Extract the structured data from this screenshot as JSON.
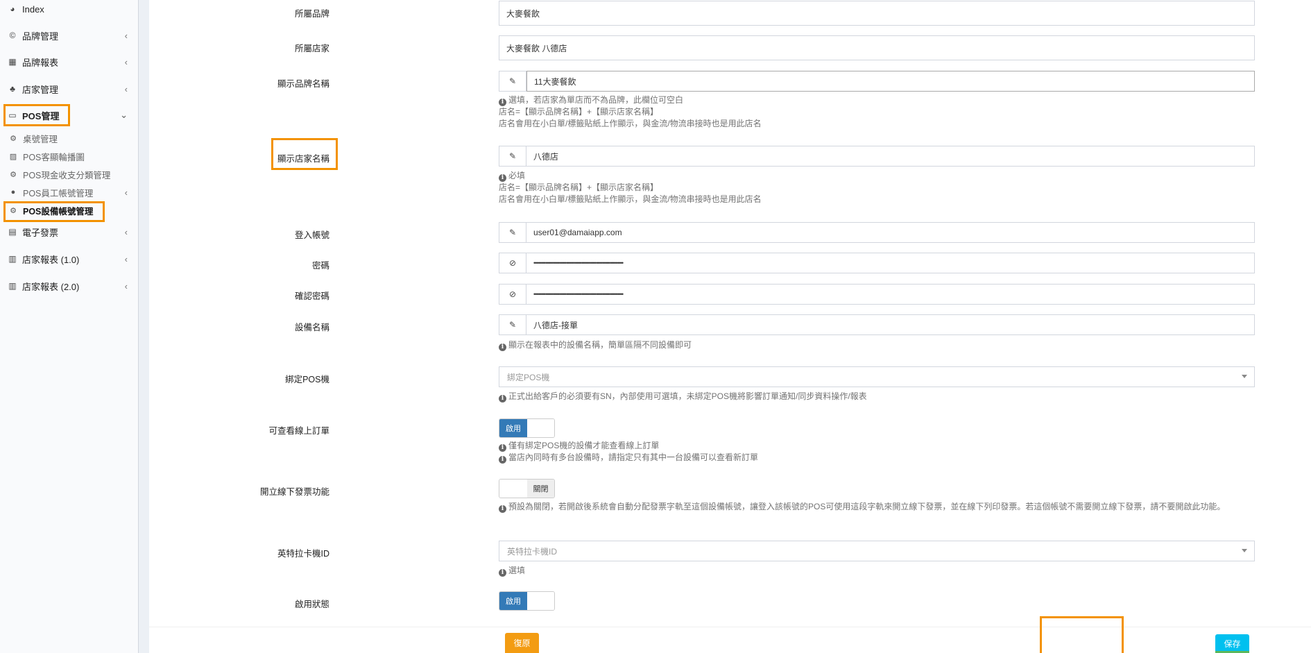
{
  "sidebar": {
    "items": [
      {
        "label": "Index",
        "icon": "dashboard-icon"
      },
      {
        "label": "品牌管理",
        "icon": "copyright-icon"
      },
      {
        "label": "品牌報表",
        "icon": "table-icon"
      },
      {
        "label": "店家管理",
        "icon": "sitemap-icon"
      },
      {
        "label": "POS管理",
        "icon": "desktop-icon"
      },
      {
        "label": "電子發票",
        "icon": "invoice-icon"
      },
      {
        "label": "店家報表 (1.0)",
        "icon": "bar-chart-icon"
      },
      {
        "label": "店家報表 (2.0)",
        "icon": "bar-chart-icon"
      }
    ],
    "pos_sub": [
      {
        "label": "桌號管理",
        "icon": "gear-icon"
      },
      {
        "label": "POS客顯輪播圖",
        "icon": "image-icon"
      },
      {
        "label": "POS現金收支分類管理",
        "icon": "gear-icon"
      },
      {
        "label": "POS員工帳號管理",
        "icon": "user-icon"
      },
      {
        "label": "POS設備帳號管理",
        "icon": "gear-icon"
      }
    ]
  },
  "form": {
    "brand": {
      "label": "所屬品牌",
      "value": "大麥餐飲"
    },
    "store": {
      "label": "所屬店家",
      "value": "大麥餐飲 八德店"
    },
    "display_brand": {
      "label": "顯示品牌名稱",
      "value": "11大麥餐飲",
      "help": [
        "選填，若店家為單店而不為品牌，此欄位可空白",
        "店名=【顯示品牌名稱】+【顯示店家名稱】",
        "店名會用在小白單/標籤貼紙上作顯示，與金流/物流串接時也是用此店名"
      ]
    },
    "display_store": {
      "label": "顯示店家名稱",
      "value": "八德店",
      "help": [
        "必填",
        "店名=【顯示品牌名稱】+【顯示店家名稱】",
        "店名會用在小白單/標籤貼紙上作顯示，與金流/物流串接時也是用此店名"
      ]
    },
    "login": {
      "label": "登入帳號",
      "value": "user01@damaiapp.com"
    },
    "password": {
      "label": "密碼",
      "value": "••••••••••••••••••••••••••••••••••••••••••••••••••••••••••••"
    },
    "confirm_password": {
      "label": "確認密碼",
      "value": "••••••••••••••••••••••••••••••••••••••••••••••••••••••••••••"
    },
    "device_name": {
      "label": "設備名稱",
      "value": "八德店-接單",
      "help": "顯示在報表中的設備名稱，簡單區隔不同設備即可"
    },
    "bind_pos": {
      "label": "綁定POS機",
      "placeholder": "綁定POS機",
      "help": "正式出給客戶的必須要有SN，內部使用可選填，未綁定POS機將影響訂單通知/同步資料操作/報表"
    },
    "online_orders": {
      "label": "可查看線上訂單",
      "toggle": "啟用",
      "help": [
        "僅有綁定POS機的設備才能查看線上訂單",
        "當店內同時有多台設備時，請指定只有其中一台設備可以查看新訂單"
      ]
    },
    "offline_invoice": {
      "label": "開立線下發票功能",
      "toggle": "關閉",
      "help": "預設為關閉，若開啟後系統會自動分配發票字軌至這個設備帳號，讓登入該帳號的POS可使用這段字軌來開立線下發票，並在線下列印發票。若這個帳號不需要開立線下發票，請不要開啟此功能。"
    },
    "etag_id": {
      "label": "英特拉卡機ID",
      "placeholder": "英特拉卡機ID",
      "help": "選填"
    },
    "enabled": {
      "label": "啟用狀態",
      "toggle": "啟用"
    }
  },
  "buttons": {
    "reset": "復原",
    "save": "保存"
  },
  "colors": {
    "highlight": "#f39200",
    "toggle_on": "#337ab7",
    "reset": "#f39c12",
    "save": "#00c0ef"
  }
}
